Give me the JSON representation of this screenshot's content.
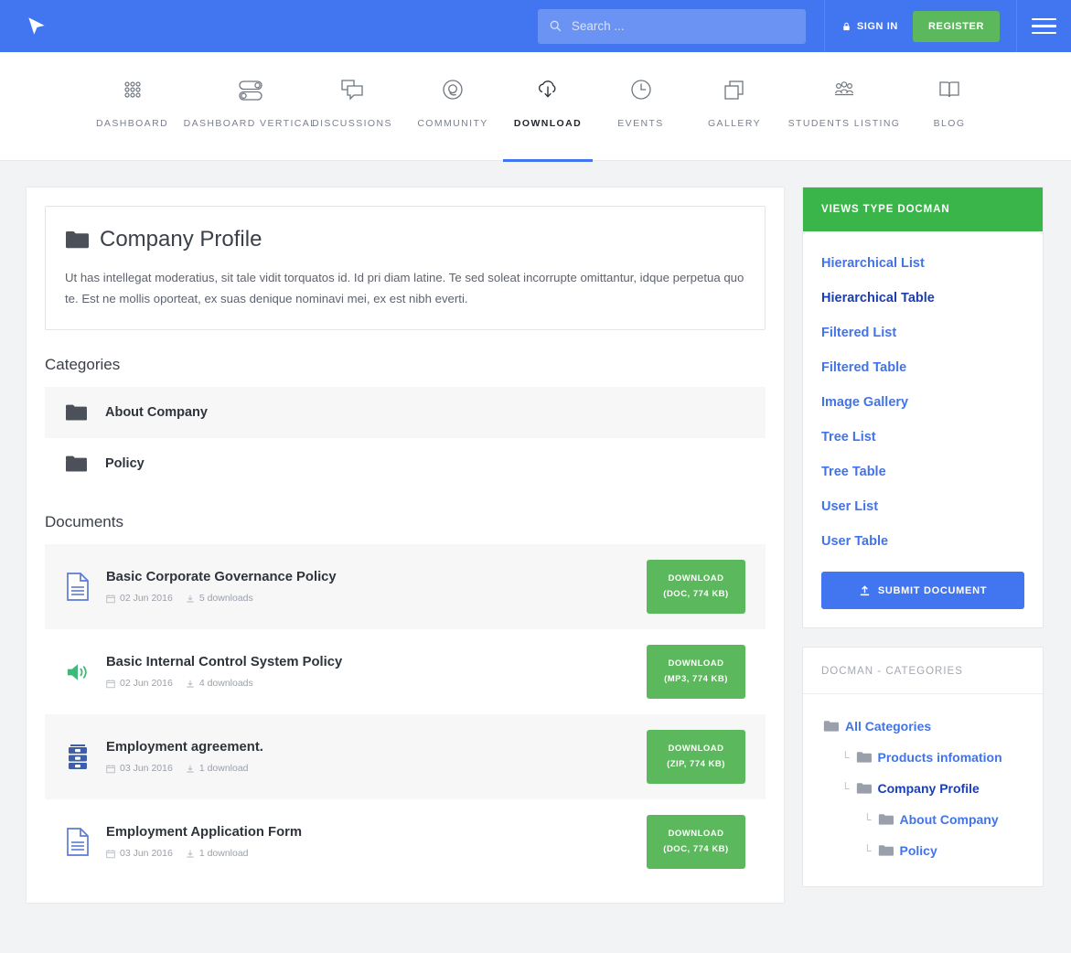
{
  "topbar": {
    "logo_name": "cursor-logo",
    "search": {
      "placeholder": "Search ...",
      "value": ""
    },
    "signin_label": "SIGN IN",
    "register_label": "REGISTER"
  },
  "nav": {
    "items": [
      {
        "label": "DASHBOARD",
        "icon": "grid-dots-icon",
        "active": false
      },
      {
        "label": "DASHBOARD VERTICAL",
        "icon": "toggles-icon",
        "active": false
      },
      {
        "label": "DISCUSSIONS",
        "icon": "chat-bubbles-icon",
        "active": false
      },
      {
        "label": "COMMUNITY",
        "icon": "circle-target-icon",
        "active": false
      },
      {
        "label": "DOWNLOAD",
        "icon": "cloud-download-icon",
        "active": true
      },
      {
        "label": "EVENTS",
        "icon": "clock-icon",
        "active": false
      },
      {
        "label": "GALLERY",
        "icon": "layers-icon",
        "active": false
      },
      {
        "label": "STUDENTS LISTING",
        "icon": "people-group-icon",
        "active": false
      },
      {
        "label": "BLOG",
        "icon": "open-book-icon",
        "active": false
      }
    ]
  },
  "main": {
    "intro": {
      "title": "Company Profile",
      "icon": "folder-icon",
      "text": "Ut has intellegat moderatius, sit tale vidit torquatos id. Id pri diam latine. Te sed soleat incorrupte omittantur, idque perpetua quo te. Est ne mollis oporteat, ex suas denique nominavi mei, ex est nibh everti."
    },
    "categories_heading": "Categories",
    "categories": [
      {
        "label": "About Company",
        "icon": "folder-icon"
      },
      {
        "label": "Policy",
        "icon": "folder-icon"
      }
    ],
    "documents_heading": "Documents",
    "documents": [
      {
        "title": "Basic Corporate Governance Policy",
        "icon": "file-document-icon",
        "date": "02 Jun 2016",
        "downloads": "5 downloads",
        "button_line1": "DOWNLOAD",
        "button_line2": "(DOC, 774 KB)"
      },
      {
        "title": "Basic Internal Control System Policy",
        "icon": "file-audio-icon",
        "date": "02 Jun 2016",
        "downloads": "4 downloads",
        "button_line1": "DOWNLOAD",
        "button_line2": "(MP3, 774 KB)"
      },
      {
        "title": "Employment agreement.",
        "icon": "file-archive-icon",
        "date": "03 Jun 2016",
        "downloads": "1 download",
        "button_line1": "DOWNLOAD",
        "button_line2": "(ZIP, 774 KB)"
      },
      {
        "title": "Employment Application Form",
        "icon": "file-document-icon",
        "date": "03 Jun 2016",
        "downloads": "1 download",
        "button_line1": "DOWNLOAD",
        "button_line2": "(DOC, 774 KB)"
      }
    ]
  },
  "sidebar": {
    "views_widget": {
      "title": "VIEWS TYPE DOCMAN",
      "links": [
        {
          "label": "Hierarchical List",
          "active": false
        },
        {
          "label": "Hierarchical Table",
          "active": true
        },
        {
          "label": "Filtered List",
          "active": false
        },
        {
          "label": "Filtered Table",
          "active": false
        },
        {
          "label": "Image Gallery",
          "active": false
        },
        {
          "label": "Tree List",
          "active": false
        },
        {
          "label": "Tree Table",
          "active": false
        },
        {
          "label": "User List",
          "active": false
        },
        {
          "label": "User Table",
          "active": false
        }
      ],
      "submit_label": "SUBMIT DOCUMENT"
    },
    "categories_widget": {
      "title": "DOCMAN - CATEGORIES",
      "tree": [
        {
          "label": "All Categories",
          "level": 0,
          "elbow": false,
          "current": false
        },
        {
          "label": "Products infomation",
          "level": 1,
          "elbow": true,
          "current": false
        },
        {
          "label": "Company Profile",
          "level": 1,
          "elbow": true,
          "current": true
        },
        {
          "label": "About Company",
          "level": 2,
          "elbow": true,
          "current": false
        },
        {
          "label": "Policy",
          "level": 2,
          "elbow": true,
          "current": false
        }
      ]
    }
  },
  "colors": {
    "brand_blue": "#4275f0",
    "green": "#5cb85c",
    "widget_green": "#3ab54a",
    "link_blue": "#4274e8",
    "page_bg": "#f2f3f5"
  }
}
